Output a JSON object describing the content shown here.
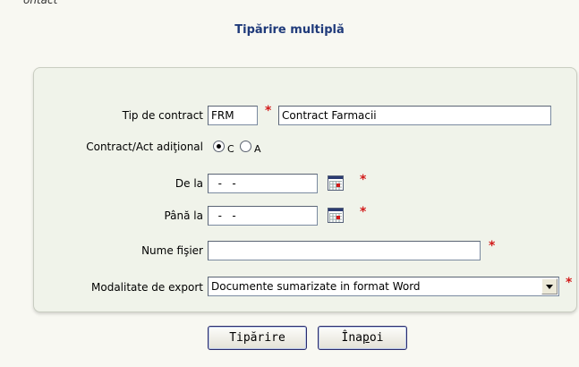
{
  "header": {
    "fragment": "ontact",
    "title": "Tipărire multiplă"
  },
  "form": {
    "contract_type": {
      "label": "Tip de contract",
      "code": "FRM",
      "name": "Contract Farmacii"
    },
    "contract_kind": {
      "label": "Contract/Act adiţional",
      "option_c": "C",
      "option_a": "A",
      "selected": "C"
    },
    "from_date": {
      "label": "De la",
      "value": "  -   -"
    },
    "to_date": {
      "label": "Până la",
      "value": "  -   -"
    },
    "file_name": {
      "label": "Nume fişier",
      "value": ""
    },
    "export_mode": {
      "label": "Modalitate de export",
      "value": "Documente sumarizate in format Word"
    },
    "required_marker": "*"
  },
  "buttons": {
    "print_label": "Tipărire",
    "back_prefix": "Îna",
    "back_underlined": "p",
    "back_suffix": "oi"
  },
  "colors": {
    "title": "#1f3a7a",
    "required": "#d21a1a",
    "panel_bg": "#f0f3ea",
    "page_bg": "#f8f8f2"
  }
}
